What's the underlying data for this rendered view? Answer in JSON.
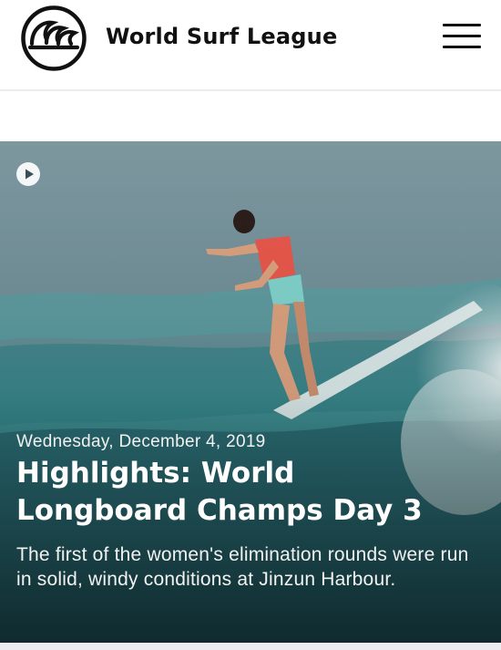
{
  "header": {
    "brand": "World Surf League",
    "logo_icon": "wsl-wave-logo-icon",
    "menu_icon": "hamburger-menu-icon"
  },
  "article": {
    "media_icon": "play-icon",
    "date": "Wednesday, December 4, 2019",
    "title": "Highlights: World Longboard Champs Day 3",
    "description": "The first of the women's elimination rounds were run in solid, windy conditions at Jinzun Harbour."
  },
  "colors": {
    "text_dark": "#111111",
    "overlay_text": "#ffffff",
    "ocean": "#3f8c91"
  }
}
